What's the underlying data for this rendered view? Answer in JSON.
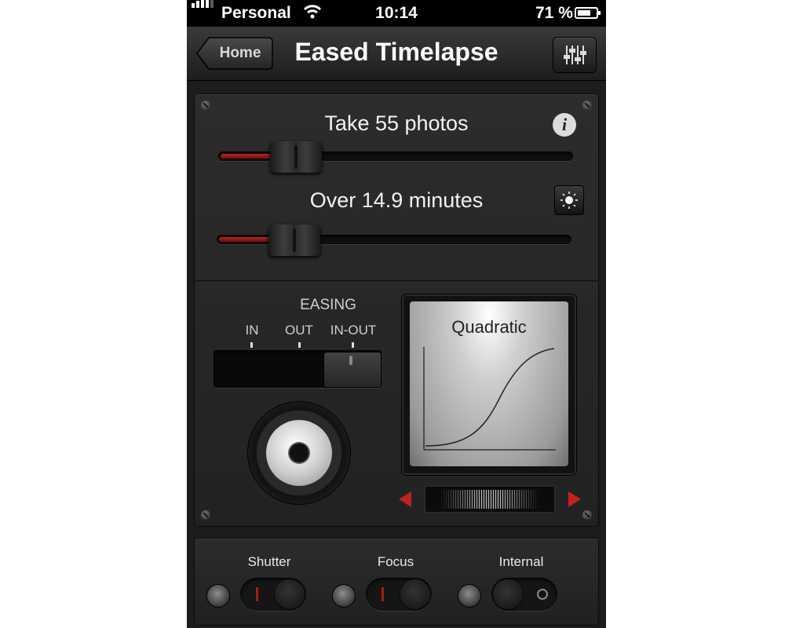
{
  "status_bar": {
    "carrier": "Personal",
    "time": "10:14",
    "battery": "71 %",
    "battery_level": 0.71
  },
  "nav": {
    "back_label": "Home",
    "title": "Eased Timelapse"
  },
  "controls": {
    "photos_label": "Take 55 photos",
    "photos_slider": 0.22,
    "duration_label": "Over 14.9 minutes",
    "duration_slider": 0.22
  },
  "easing": {
    "title": "EASING",
    "options": [
      "IN",
      "OUT",
      "IN-OUT"
    ],
    "selected": "IN-OUT"
  },
  "curve_display": {
    "name": "Quadratic"
  },
  "toggles": [
    {
      "label": "Shutter",
      "state": "on"
    },
    {
      "label": "Focus",
      "state": "on"
    },
    {
      "label": "Internal",
      "state": "off"
    }
  ],
  "icons": {
    "back": "chevron-left-icon",
    "settings": "mixer-sliders-icon",
    "info": "info-icon",
    "brightness": "sun-icon",
    "prev": "triangle-left-icon",
    "next": "triangle-right-icon"
  },
  "colors": {
    "accent_red": "#c0221f",
    "panel": "#2a2a2a",
    "background": "#1c1c1c"
  }
}
